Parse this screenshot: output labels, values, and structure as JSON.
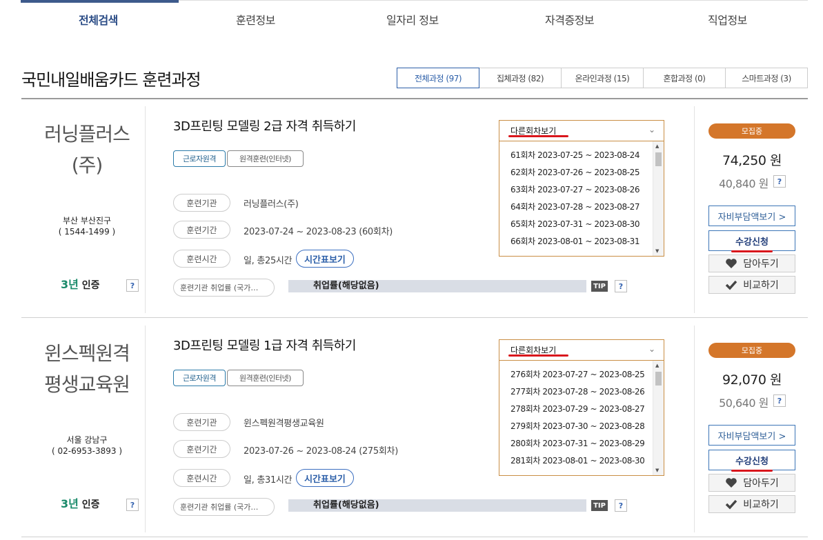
{
  "top_tabs": [
    "전체검색",
    "훈련정보",
    "일자리 정보",
    "자격증정보",
    "직업정보"
  ],
  "page_title": "국민내일배움카드 훈련과정",
  "filters": [
    "전체과정 (97)",
    "집체과정 (82)",
    "온라인과정 (15)",
    "혼합과정 (0)",
    "스마트과정 (3)"
  ],
  "labels": {
    "institution": "훈련기관",
    "period": "훈련기간",
    "hours": "훈련시간",
    "time_table": "시간표보기",
    "employment": "훈련기관 취업률 (국가…",
    "employment_value": "취업률(해당없음)",
    "tip": "TIP",
    "question": "?",
    "dropdown": "다른회차보기",
    "self_pay": "자비부담액보기 >",
    "apply": "수강신청",
    "wishlist": "담아두기",
    "compare": "비교하기",
    "cert_num": "3년",
    "cert_text": "인증"
  },
  "courses": [
    {
      "institution_line1": "러닝플러스",
      "institution_line2": "(주)",
      "location": "부산 부산진구",
      "phone": "( 1544-1499 )",
      "title": "3D프린팅 모델링 2급 자격 취득하기",
      "tag1": "근로자원격",
      "tag2": "원격훈련(인터넷)",
      "institution": "러닝플러스(주)",
      "period": "2023-07-24 ~ 2023-08-23 (60회차)",
      "hours": "일, 총25시간",
      "sessions": [
        "61회차 2023-07-25 ~ 2023-08-24",
        "62회차 2023-07-26 ~ 2023-08-25",
        "63회차 2023-07-27 ~ 2023-08-26",
        "64회차 2023-07-28 ~ 2023-08-27",
        "65회차 2023-07-31 ~ 2023-08-30",
        "66회차 2023-08-01 ~ 2023-08-31"
      ],
      "status": "모집중",
      "price": "74,250 원",
      "self_price": "40,840 원"
    },
    {
      "institution_line1": "윈스펙원격",
      "institution_line2": "평생교육원",
      "location": "서울 강남구",
      "phone": "( 02-6953-3893 )",
      "title": "3D프린팅 모델링 1급 자격 취득하기",
      "tag1": "근로자원격",
      "tag2": "원격훈련(인터넷)",
      "institution": "윈스펙원격평생교육원",
      "period": "2023-07-26 ~ 2023-08-24 (275회차)",
      "hours": "일, 총31시간",
      "sessions": [
        "276회차 2023-07-27 ~ 2023-08-25",
        "277회차 2023-07-28 ~ 2023-08-26",
        "278회차 2023-07-29 ~ 2023-08-27",
        "279회차 2023-07-30 ~ 2023-08-28",
        "280회차 2023-07-31 ~ 2023-08-29",
        "281회차 2023-08-01 ~ 2023-08-30"
      ],
      "status": "모집중",
      "price": "92,070 원",
      "self_price": "50,640 원"
    }
  ],
  "colors": {
    "accent": "#2b5ea8",
    "status_badge": "#d4762a",
    "dropdown_border": "#c98e44",
    "annotation_red": "#d9161c"
  }
}
